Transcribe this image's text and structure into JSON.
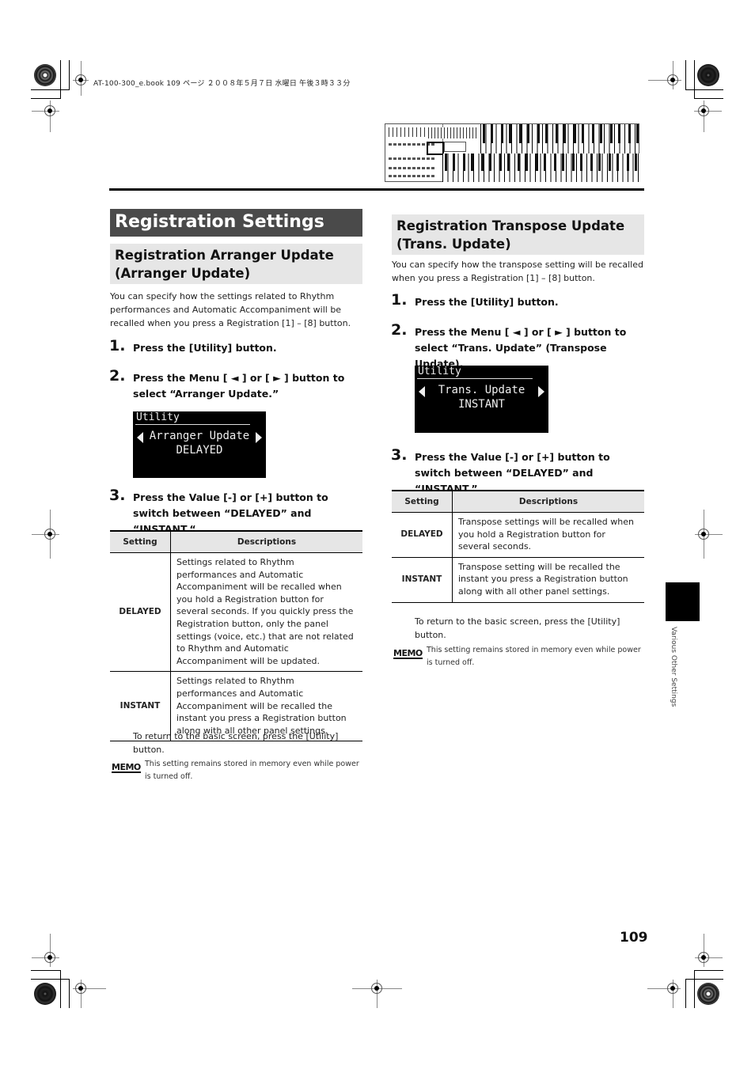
{
  "print_header": {
    "file_info": "AT-100-300_e.book  109 ページ  ２００８年５月７日  水曜日  午後３時３３分"
  },
  "illustration": {
    "icon": "organ-keyboard-panel-icon"
  },
  "section": {
    "title": "Registration Settings"
  },
  "left": {
    "heading_line1": "Registration Arranger Update",
    "heading_line2": "(Arranger Update)",
    "intro": "You can specify how the settings related to Rhythm performances and Automatic Accompaniment will be recalled when you press a Registration [1] – [8] button.",
    "steps": [
      {
        "num": "1.",
        "text": "Press the [Utility] button."
      },
      {
        "num": "2.",
        "text": "Press the Menu [ ◄ ] or [ ► ] button to select “Arranger Update.”"
      },
      {
        "num": "3.",
        "text": "Press the Value [-] or [+] button to switch between “DELAYED” and “INSTANT.“"
      }
    ],
    "lcd": {
      "title": "Utility",
      "line1": "Arranger Update",
      "line2": "DELAYED"
    },
    "table": {
      "headers": [
        "Setting",
        "Descriptions"
      ],
      "rows": [
        {
          "setting": "DELAYED",
          "description": "Settings related to Rhythm performances and Automatic Accompaniment will be recalled when you hold a Registration button for several seconds. If you quickly press the Registration button, only the panel settings (voice, etc.) that are not related to Rhythm and Automatic Accompaniment will be updated."
        },
        {
          "setting": "INSTANT",
          "description": "Settings related to Rhythm performances and Automatic Accompaniment will be recalled the instant you press a Registration button along with all other panel settings."
        }
      ]
    },
    "return_note": "To return to the basic screen, press the [Utility] button.",
    "memo_label": "MEMO",
    "memo_text": "This setting remains stored in memory even while power is turned off."
  },
  "right": {
    "heading_line1": "Registration Transpose Update",
    "heading_line2": "(Trans. Update)",
    "intro": "You can specify how the transpose setting will be recalled when you press a Registration [1] – [8] button.",
    "steps": [
      {
        "num": "1.",
        "text": "Press the [Utility] button."
      },
      {
        "num": "2.",
        "text": "Press the Menu [ ◄ ] or [ ► ] button to select “Trans. Update” (Transpose Update)."
      },
      {
        "num": "3.",
        "text": "Press the Value [-] or [+] button to switch between “DELAYED” and “INSTANT.”"
      }
    ],
    "lcd": {
      "title": "Utility",
      "line1": "Trans. Update",
      "line2": "INSTANT"
    },
    "table": {
      "headers": [
        "Setting",
        "Descriptions"
      ],
      "rows": [
        {
          "setting": "DELAYED",
          "description": "Transpose settings will be recalled when you hold a Registration button for several seconds."
        },
        {
          "setting": "INSTANT",
          "description": "Transpose setting will be recalled the instant you press a Registration button along with all other panel settings."
        }
      ]
    },
    "return_note": "To return to the basic screen, press the [Utility] button.",
    "memo_label": "MEMO",
    "memo_text": "This setting remains stored in memory even while power is turned off."
  },
  "side_tab": {
    "label": "Various Other Settings"
  },
  "footer": {
    "page_number": "109"
  }
}
